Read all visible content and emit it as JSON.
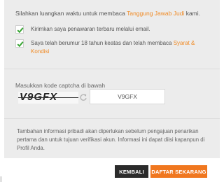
{
  "terms": {
    "intro_prefix": "Silahkan luangkan waktu untuk membaca ",
    "intro_link": "Tanggung Jawab Judi",
    "intro_suffix": " kami.",
    "options": [
      {
        "label": "Kirimkan saya penawaran terbaru melalui email.",
        "link": "",
        "checked": true
      },
      {
        "label": "Saya telah berumur 18 tahun keatas dan telah membaca ",
        "link": "Syarat & Kondisi",
        "checked": true
      }
    ]
  },
  "captcha": {
    "label": "Masukkan kode captcha di bawah",
    "image_text": "V9GFX",
    "input_value": "V9GFX"
  },
  "info": {
    "text": "Tambahan informasi pribadi akan diperlukan sebelum pengajuan penarikan pertama dan untuk tujuan verifikasi akun. Informasi ini dapat diisi kapanpun di Profil Anda."
  },
  "buttons": {
    "back_label": "KEMBALI",
    "register_label": "DAFTAR SEKARANG"
  },
  "colors": {
    "accent": "#f08a24",
    "check": "#3aa635",
    "panel": "#ececec",
    "back_button": "#2b2b2b",
    "register_button": "#f0771f"
  },
  "icons": {
    "checkbox": "check-icon",
    "refresh": "refresh-icon"
  }
}
